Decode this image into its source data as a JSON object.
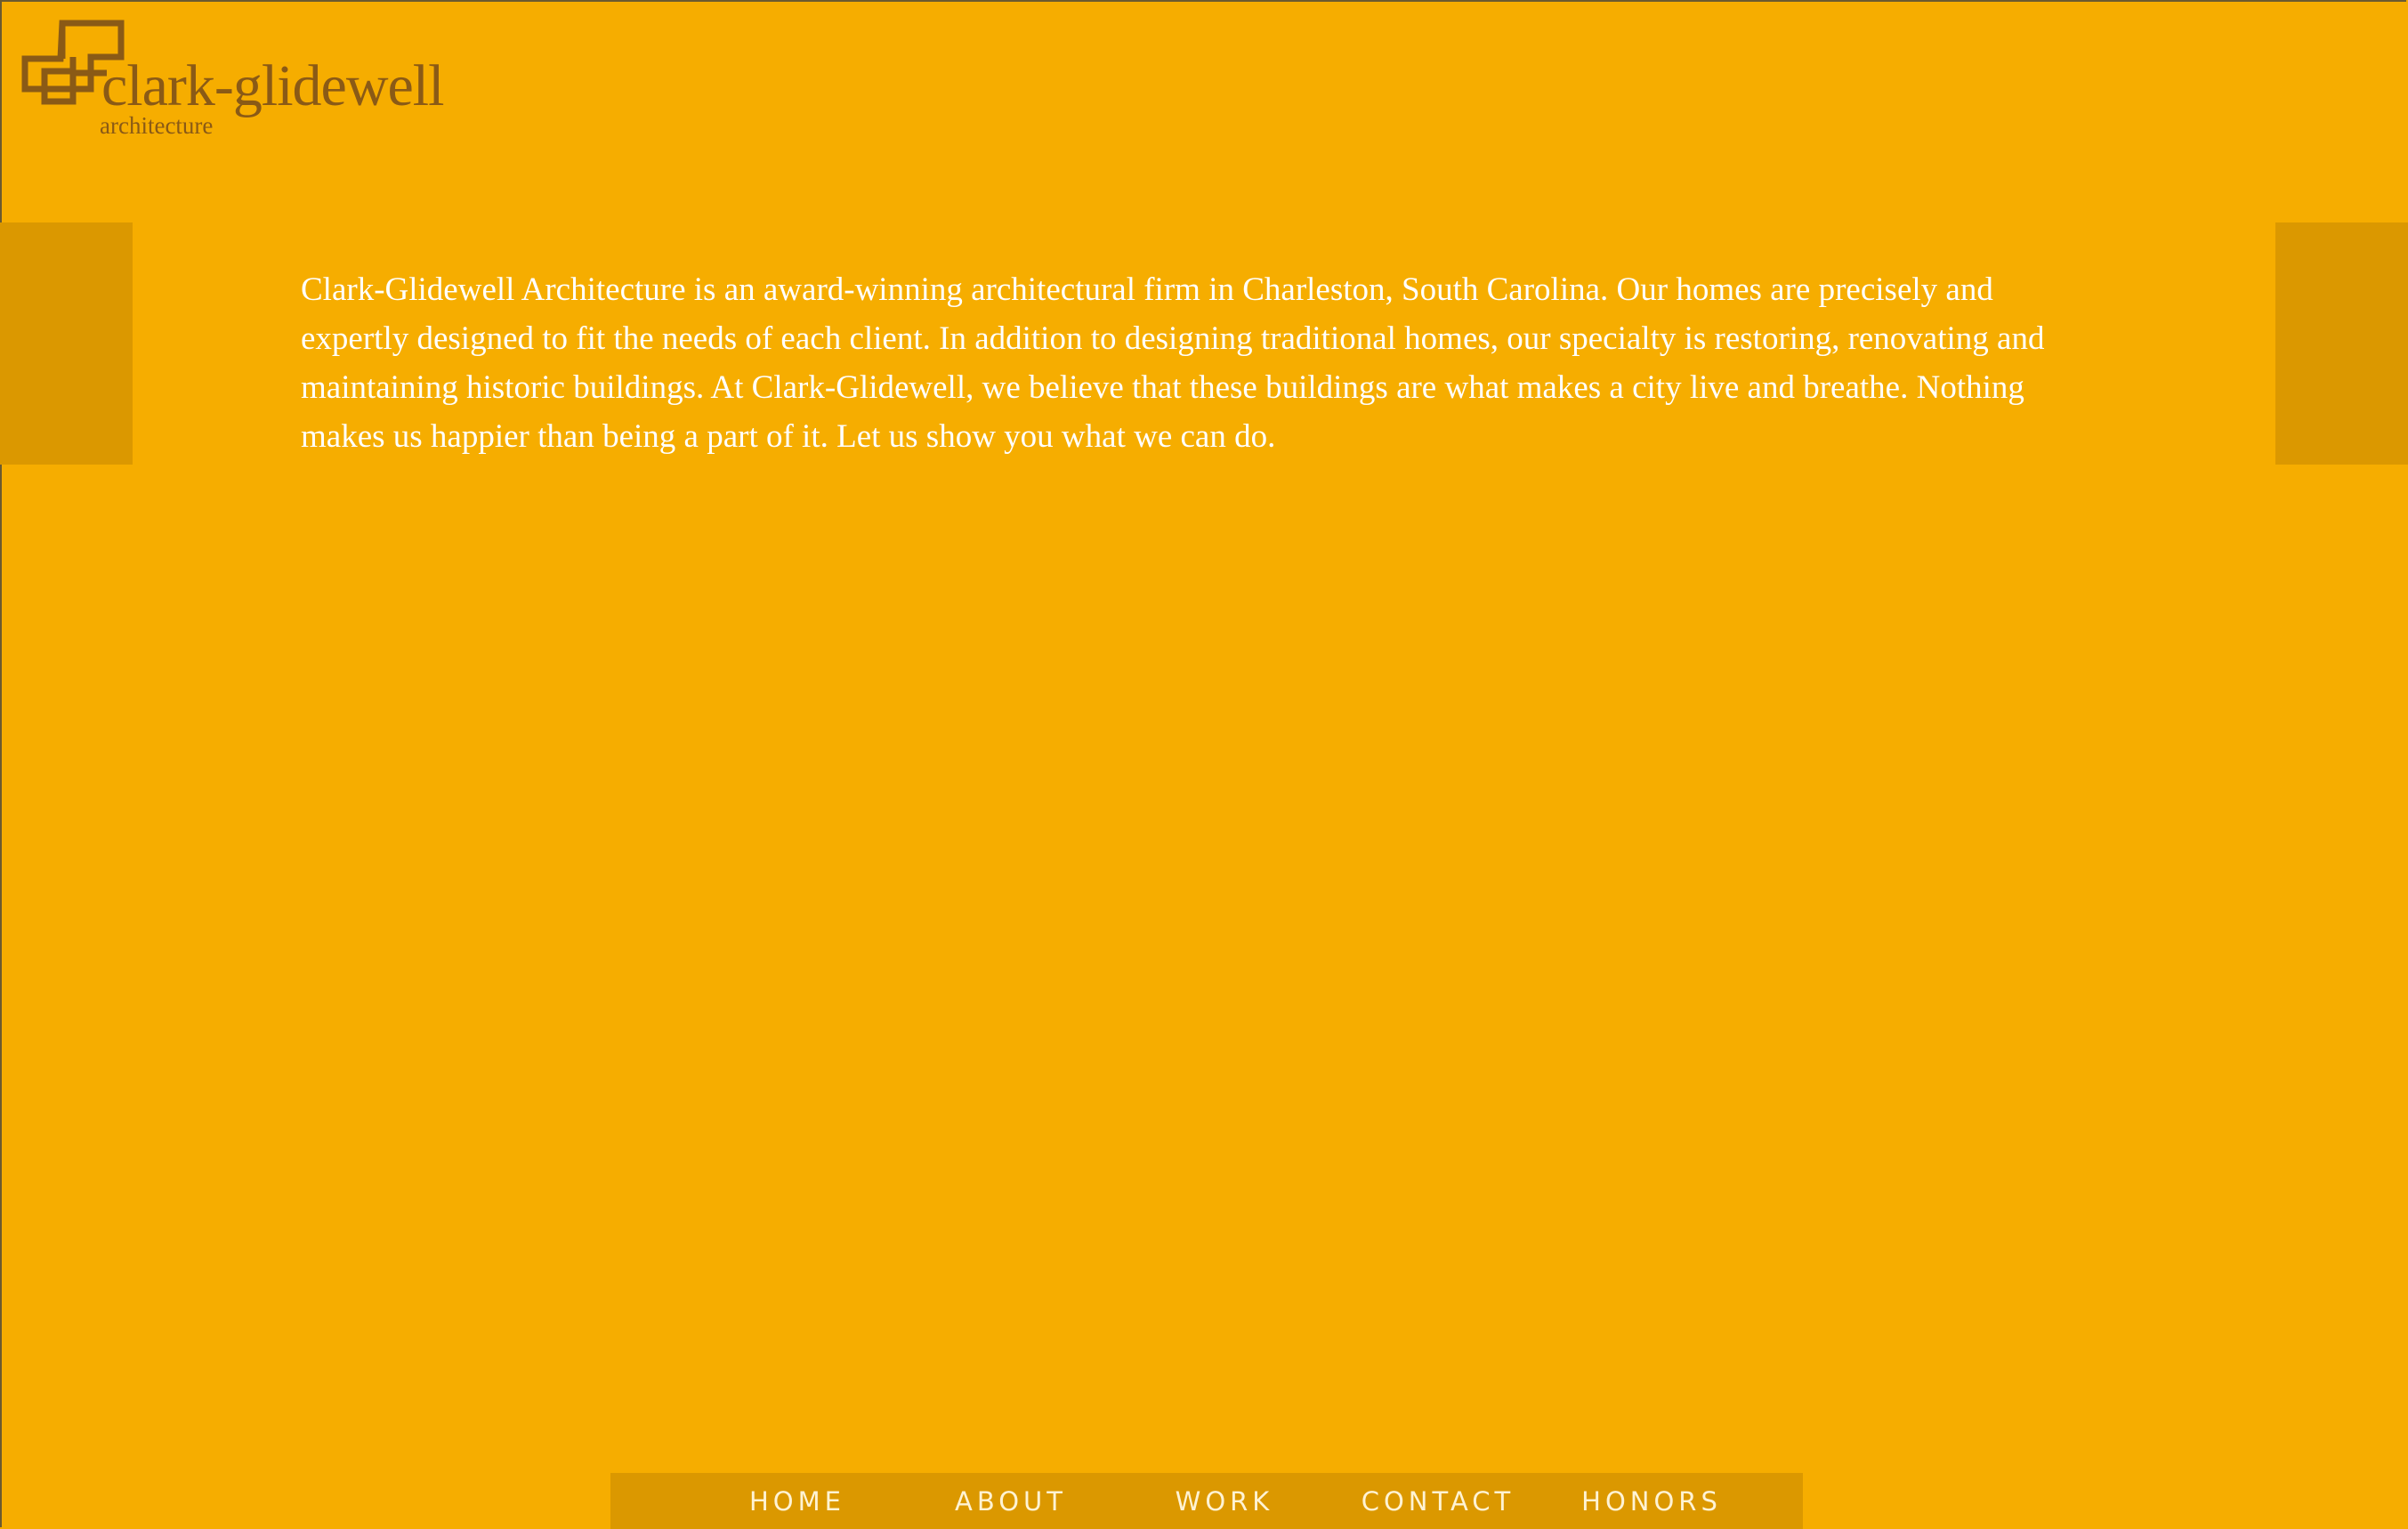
{
  "brand": {
    "name": "clark-glidewell",
    "subtitle": "architecture",
    "logo_icon": "interlocking-squares-logo-icon"
  },
  "intro": {
    "text": "Clark-Glidewell Architecture is an award-winning architectural firm in Charleston, South Carolina. Our homes are precisely and expertly designed to fit the needs of each client. In addition to designing traditional homes, our specialty is restoring, renovating and maintaining historic buildings. At Clark-Glidewell, we believe that these buildings are what makes a city live and breathe. Nothing makes us happier than being a part of it. Let us show you what we can do."
  },
  "nav": {
    "items": [
      {
        "label": "HOME"
      },
      {
        "label": "ABOUT"
      },
      {
        "label": "WORK"
      },
      {
        "label": "CONTACT"
      },
      {
        "label": "HONORS"
      }
    ]
  },
  "colors": {
    "background": "#f6ad00",
    "panel": "#db9800",
    "brand_brown": "#8a5a16",
    "text": "#ffffff"
  }
}
